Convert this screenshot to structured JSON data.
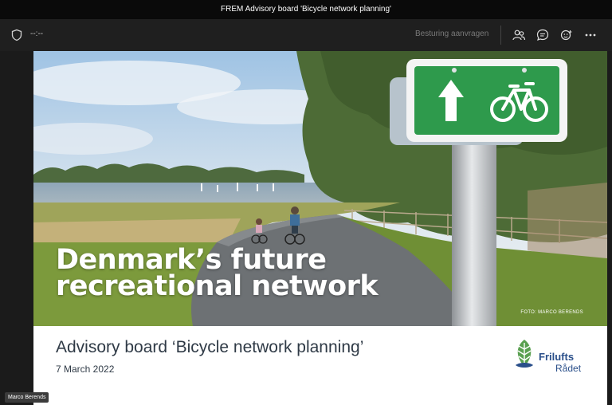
{
  "window": {
    "title": "FREM Advisory board 'Bicycle network planning'"
  },
  "toolbar": {
    "timer": "--:--",
    "request_control_label": "Besturing aanvragen",
    "icons": [
      "shield-icon",
      "people-icon",
      "chat-icon",
      "reactions-icon",
      "more-icon"
    ]
  },
  "slide": {
    "headline_line1": "Denmark’s future",
    "headline_line2": "recreational network",
    "photo_credit": "FOTO: MARCO BERENDS",
    "subtitle": "Advisory board ‘Bicycle network planning’",
    "date": "7 March 2022",
    "logo_line1": "Frilufts",
    "logo_line2": "Rådet"
  },
  "presenter": {
    "name": "Marco Berends"
  },
  "colors": {
    "sign_green": "#2e9a4c",
    "logo_blue": "#2a4f8a",
    "logo_green": "#5aa050"
  }
}
